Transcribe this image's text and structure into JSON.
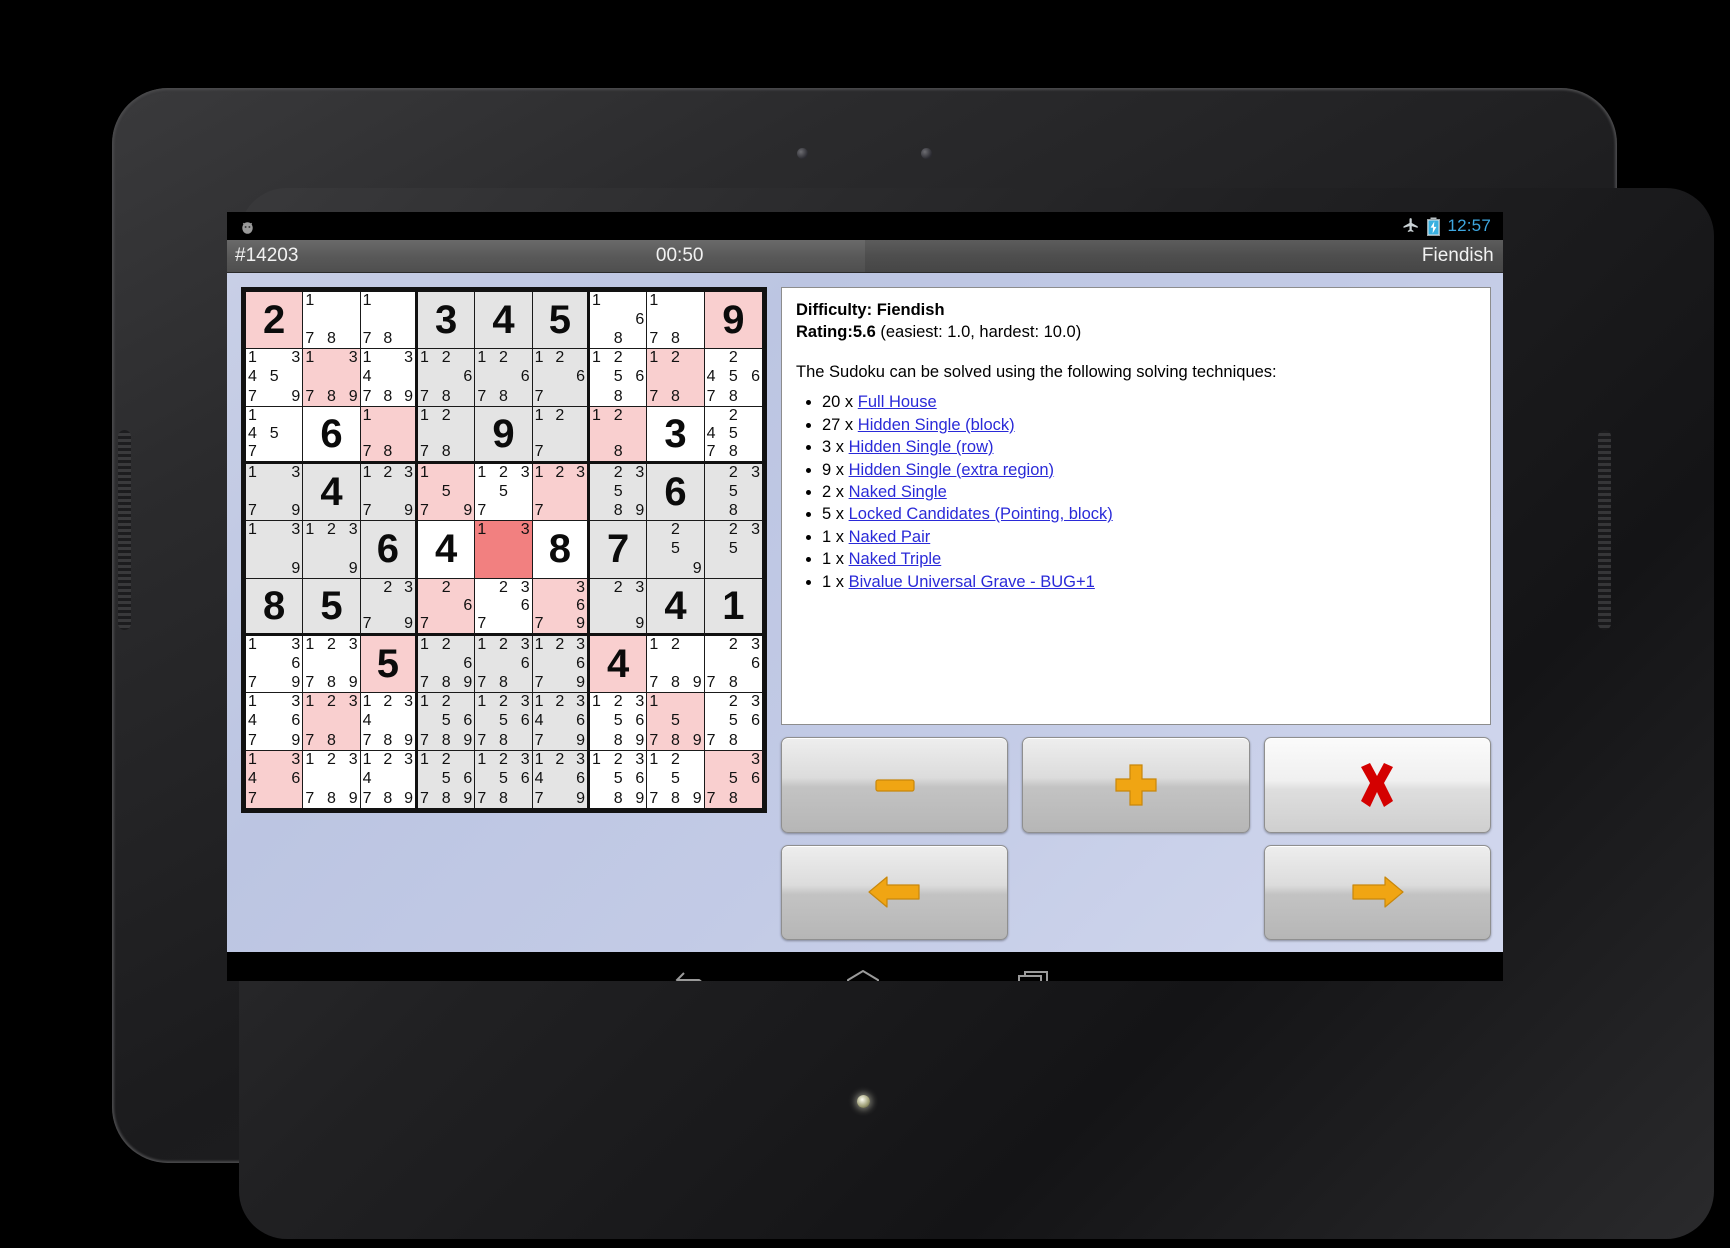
{
  "status_bar": {
    "airplane_icon": "airplane-mode-icon",
    "battery_icon": "battery-charging-icon",
    "clock": "12:57"
  },
  "title_bar": {
    "puzzle_id": "#14203",
    "timer": "00:50",
    "difficulty": "Fiendish"
  },
  "hint_panel": {
    "difficulty_label": "Difficulty:",
    "difficulty_value": "Fiendish",
    "rating_label": "Rating:",
    "rating_value": "5.6",
    "rating_suffix": "(easiest: 1.0, hardest: 10.0)",
    "intro": "The Sudoku can be solved using the following solving techniques:",
    "techniques": [
      {
        "count": "20 x",
        "name": "Full House"
      },
      {
        "count": "27 x",
        "name": "Hidden Single (block)"
      },
      {
        "count": "3 x",
        "name": "Hidden Single (row)"
      },
      {
        "count": "9 x",
        "name": "Hidden Single (extra region)"
      },
      {
        "count": "2 x",
        "name": "Naked Single"
      },
      {
        "count": "5 x",
        "name": "Locked Candidates (Pointing, block)"
      },
      {
        "count": "1 x",
        "name": "Naked Pair"
      },
      {
        "count": "1 x",
        "name": "Naked Triple"
      },
      {
        "count": "1 x",
        "name": "Bivalue Universal Grave - BUG+1"
      }
    ]
  },
  "buttons": [
    {
      "id": "minus-button",
      "icon": "minus-icon",
      "color": "#f0a513",
      "style": "normal"
    },
    {
      "id": "plus-button",
      "icon": "plus-icon",
      "color": "#f0a513",
      "style": "normal"
    },
    {
      "id": "close-button",
      "icon": "x-mark-icon",
      "color": "#d40000",
      "style": "light"
    },
    {
      "id": "previous-button",
      "icon": "arrow-left-icon",
      "color": "#f0a513",
      "style": "normal"
    },
    {
      "id": "next-button",
      "icon": "arrow-right-icon",
      "color": "#f0a513",
      "style": "normal"
    }
  ],
  "nav_bar": [
    {
      "id": "back-button",
      "icon": "back-arrow-icon"
    },
    {
      "id": "home-button",
      "icon": "home-icon"
    },
    {
      "id": "recents-button",
      "icon": "recent-apps-icon"
    }
  ],
  "colors": {
    "highlight_pink": "#f9cfcf",
    "highlight_hot": "#f28080",
    "shaded_cell": "#e4e4e4",
    "plain_cell": "#ffffff",
    "link": "#2a2ad8",
    "accent_orange": "#f0a513",
    "accent_red": "#d40000"
  },
  "grid": {
    "rows": [
      [
        {
          "v": "2",
          "bg": "pink"
        },
        {
          "c": [
            1,
            7,
            8
          ],
          "bg": "plain"
        },
        {
          "c": [
            1,
            7,
            8
          ],
          "bg": "plain"
        },
        {
          "v": "3",
          "bg": "shaded"
        },
        {
          "v": "4",
          "bg": "shaded"
        },
        {
          "v": "5",
          "bg": "shaded"
        },
        {
          "c": [
            1,
            6,
            8
          ],
          "bg": "plain"
        },
        {
          "c": [
            1,
            7,
            8
          ],
          "bg": "plain"
        },
        {
          "v": "9",
          "bg": "pink"
        }
      ],
      [
        {
          "c": [
            1,
            3,
            4,
            5,
            7,
            9
          ],
          "bg": "plain"
        },
        {
          "c": [
            1,
            3,
            7,
            8,
            9
          ],
          "bg": "pink"
        },
        {
          "c": [
            1,
            3,
            4,
            7,
            8,
            9
          ],
          "bg": "plain"
        },
        {
          "c": [
            1,
            2,
            6,
            7,
            8
          ],
          "bg": "shaded"
        },
        {
          "c": [
            1,
            2,
            6,
            7,
            8
          ],
          "bg": "shaded"
        },
        {
          "c": [
            1,
            2,
            6,
            7
          ],
          "bg": "shaded"
        },
        {
          "c": [
            1,
            2,
            5,
            6,
            8
          ],
          "bg": "plain"
        },
        {
          "c": [
            1,
            2,
            7,
            8
          ],
          "bg": "pink"
        },
        {
          "c": [
            2,
            4,
            5,
            6,
            7,
            8
          ],
          "bg": "plain"
        }
      ],
      [
        {
          "c": [
            1,
            4,
            5,
            7
          ],
          "bg": "plain"
        },
        {
          "v": "6",
          "bg": "plain"
        },
        {
          "c": [
            1,
            7,
            8
          ],
          "bg": "pink"
        },
        {
          "c": [
            1,
            2,
            7,
            8
          ],
          "bg": "shaded"
        },
        {
          "v": "9",
          "bg": "shaded"
        },
        {
          "c": [
            1,
            2,
            7
          ],
          "bg": "shaded"
        },
        {
          "c": [
            1,
            2,
            8
          ],
          "bg": "pink"
        },
        {
          "v": "3",
          "bg": "plain"
        },
        {
          "c": [
            2,
            4,
            5,
            7,
            8
          ],
          "bg": "plain"
        }
      ],
      [
        {
          "c": [
            1,
            3,
            7,
            9
          ],
          "bg": "shaded"
        },
        {
          "v": "4",
          "bg": "shaded"
        },
        {
          "c": [
            1,
            2,
            3,
            7,
            9
          ],
          "bg": "shaded"
        },
        {
          "c": [
            1,
            5,
            7,
            9
          ],
          "bg": "pink"
        },
        {
          "c": [
            1,
            2,
            3,
            5,
            7
          ],
          "bg": "plain"
        },
        {
          "c": [
            1,
            2,
            3,
            7
          ],
          "bg": "pink"
        },
        {
          "c": [
            2,
            3,
            5,
            8,
            9
          ],
          "bg": "shaded"
        },
        {
          "v": "6",
          "bg": "shaded"
        },
        {
          "c": [
            2,
            3,
            5,
            8
          ],
          "bg": "shaded"
        }
      ],
      [
        {
          "c": [
            1,
            3,
            9
          ],
          "bg": "shaded"
        },
        {
          "c": [
            1,
            2,
            3,
            9
          ],
          "bg": "shaded"
        },
        {
          "v": "6",
          "bg": "shaded"
        },
        {
          "v": "4",
          "bg": "plain"
        },
        {
          "c": [
            1,
            3
          ],
          "bg": "hot"
        },
        {
          "v": "8",
          "bg": "plain"
        },
        {
          "v": "7",
          "bg": "shaded"
        },
        {
          "c": [
            2,
            5,
            9
          ],
          "bg": "shaded"
        },
        {
          "c": [
            2,
            3,
            5
          ],
          "bg": "shaded"
        }
      ],
      [
        {
          "v": "8",
          "bg": "shaded"
        },
        {
          "v": "5",
          "bg": "shaded"
        },
        {
          "c": [
            2,
            3,
            7,
            9
          ],
          "bg": "shaded"
        },
        {
          "c": [
            2,
            6,
            7
          ],
          "bg": "pink"
        },
        {
          "c": [
            2,
            3,
            6,
            7
          ],
          "bg": "plain"
        },
        {
          "c": [
            3,
            6,
            7,
            9
          ],
          "bg": "pink"
        },
        {
          "c": [
            2,
            3,
            9
          ],
          "bg": "shaded"
        },
        {
          "v": "4",
          "bg": "shaded"
        },
        {
          "v": "1",
          "bg": "shaded"
        }
      ],
      [
        {
          "c": [
            1,
            3,
            6,
            7,
            9
          ],
          "bg": "plain"
        },
        {
          "c": [
            1,
            2,
            3,
            7,
            8,
            9
          ],
          "bg": "plain"
        },
        {
          "v": "5",
          "bg": "pink"
        },
        {
          "c": [
            1,
            2,
            6,
            7,
            8,
            9
          ],
          "bg": "shaded"
        },
        {
          "c": [
            1,
            2,
            3,
            6,
            7,
            8
          ],
          "bg": "shaded"
        },
        {
          "c": [
            1,
            2,
            3,
            6,
            7,
            9
          ],
          "bg": "shaded"
        },
        {
          "v": "4",
          "bg": "pink"
        },
        {
          "c": [
            1,
            2,
            7,
            8,
            9
          ],
          "bg": "plain"
        },
        {
          "c": [
            2,
            3,
            6,
            7,
            8
          ],
          "bg": "plain"
        }
      ],
      [
        {
          "c": [
            1,
            3,
            4,
            6,
            7,
            9
          ],
          "bg": "plain"
        },
        {
          "c": [
            1,
            2,
            3,
            7,
            8
          ],
          "bg": "pink"
        },
        {
          "c": [
            1,
            2,
            3,
            4,
            7,
            8,
            9
          ],
          "bg": "plain"
        },
        {
          "c": [
            1,
            2,
            5,
            6,
            7,
            8,
            9
          ],
          "bg": "shaded"
        },
        {
          "c": [
            1,
            2,
            3,
            5,
            6,
            7,
            8
          ],
          "bg": "shaded"
        },
        {
          "c": [
            1,
            2,
            3,
            4,
            6,
            7,
            9
          ],
          "bg": "shaded"
        },
        {
          "c": [
            1,
            2,
            3,
            5,
            6,
            8,
            9
          ],
          "bg": "plain"
        },
        {
          "c": [
            1,
            5,
            7,
            8,
            9
          ],
          "bg": "pink"
        },
        {
          "c": [
            2,
            3,
            5,
            6,
            7,
            8
          ],
          "bg": "plain"
        }
      ],
      [
        {
          "c": [
            1,
            3,
            4,
            6,
            7
          ],
          "bg": "pink"
        },
        {
          "c": [
            1,
            2,
            3,
            7,
            8,
            9
          ],
          "bg": "plain"
        },
        {
          "c": [
            1,
            2,
            3,
            4,
            7,
            8,
            9
          ],
          "bg": "plain"
        },
        {
          "c": [
            1,
            2,
            5,
            6,
            7,
            8,
            9
          ],
          "bg": "shaded"
        },
        {
          "c": [
            1,
            2,
            3,
            5,
            6,
            7,
            8
          ],
          "bg": "shaded"
        },
        {
          "c": [
            1,
            2,
            3,
            4,
            6,
            7,
            9
          ],
          "bg": "shaded"
        },
        {
          "c": [
            1,
            2,
            3,
            5,
            6,
            8,
            9
          ],
          "bg": "plain"
        },
        {
          "c": [
            1,
            2,
            5,
            7,
            8,
            9
          ],
          "bg": "plain"
        },
        {
          "c": [
            3,
            5,
            6,
            7,
            8
          ],
          "bg": "pink"
        }
      ]
    ]
  }
}
